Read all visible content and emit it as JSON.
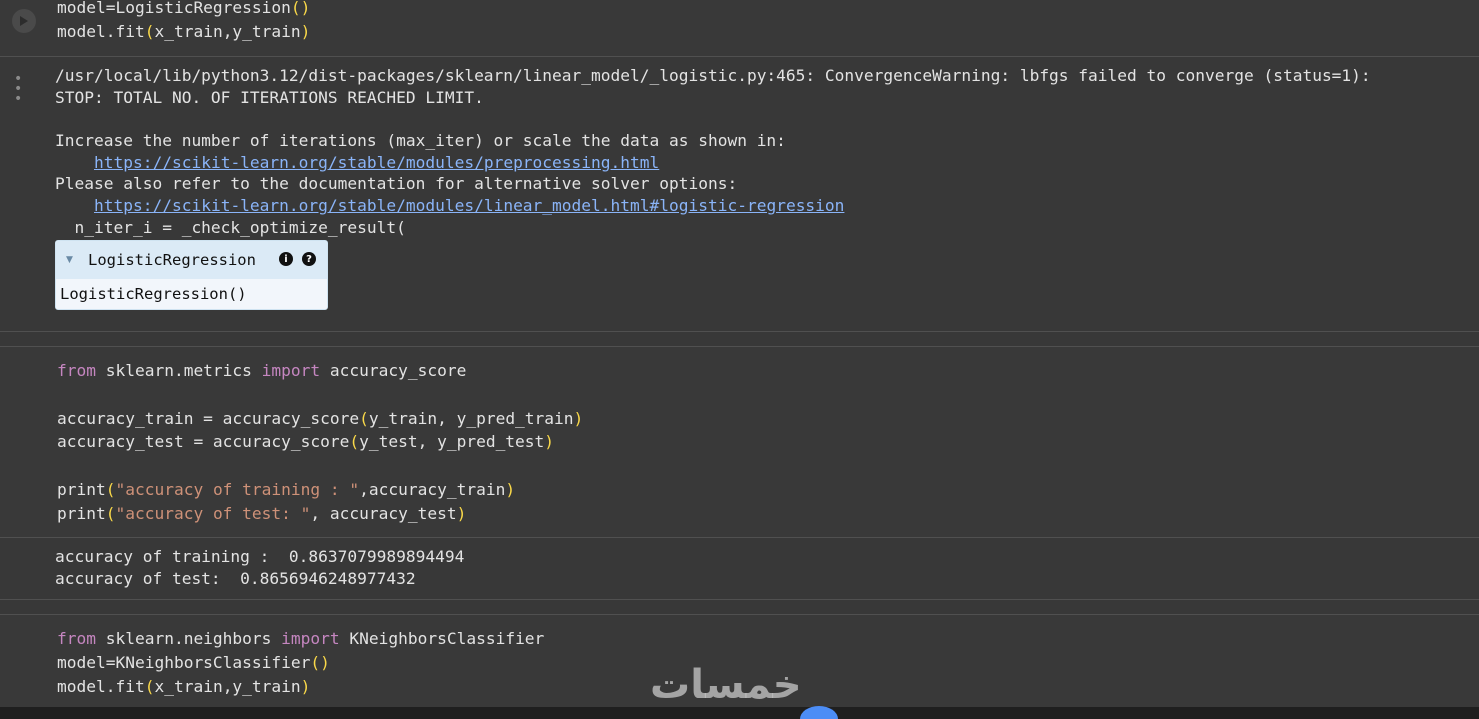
{
  "cell1": {
    "code": [
      "model=LogisticRegression()",
      "model.fit(x_train,y_train)"
    ],
    "output_lines": [
      "/usr/local/lib/python3.12/dist-packages/sklearn/linear_model/_logistic.py:465: ConvergenceWarning: lbfgs failed to converge (status=1):",
      "STOP: TOTAL NO. OF ITERATIONS REACHED LIMIT.",
      "",
      "Increase the number of iterations (max_iter) or scale the data as shown in:",
      "https://scikit-learn.org/stable/modules/preprocessing.html",
      "Please also refer to the documentation for alternative solver options:",
      "https://scikit-learn.org/stable/modules/linear_model.html#logistic-regression",
      "  n_iter_i = _check_optimize_result("
    ],
    "estimator": {
      "name": "LogisticRegression",
      "repr": "LogisticRegression()",
      "info_icon": "i",
      "help_icon": "?"
    }
  },
  "cell2": {
    "code": [
      {
        "kw": "from",
        "rest1": " sklearn.metrics ",
        "kw2": "import",
        "rest2": " accuracy_score"
      },
      "accuracy_train = accuracy_score(y_train, y_pred_train)",
      "accuracy_test = accuracy_score(y_test, y_pred_test)",
      "print(\"accuracy of training : \",accuracy_train)",
      "print(\"accuracy of test: \", accuracy_test)"
    ],
    "output": [
      "accuracy of training :  0.8637079989894494",
      "accuracy of test:  0.8656946248977432"
    ]
  },
  "cell3": {
    "code": [
      "from sklearn.neighbors import KNeighborsClassifier",
      "model=KNeighborsClassifier()",
      "model.fit(x_train,y_train)"
    ]
  },
  "watermark": "خمسات",
  "icons": {
    "run": "play-circle-icon",
    "output_menu": "more-horizontal-icon"
  }
}
